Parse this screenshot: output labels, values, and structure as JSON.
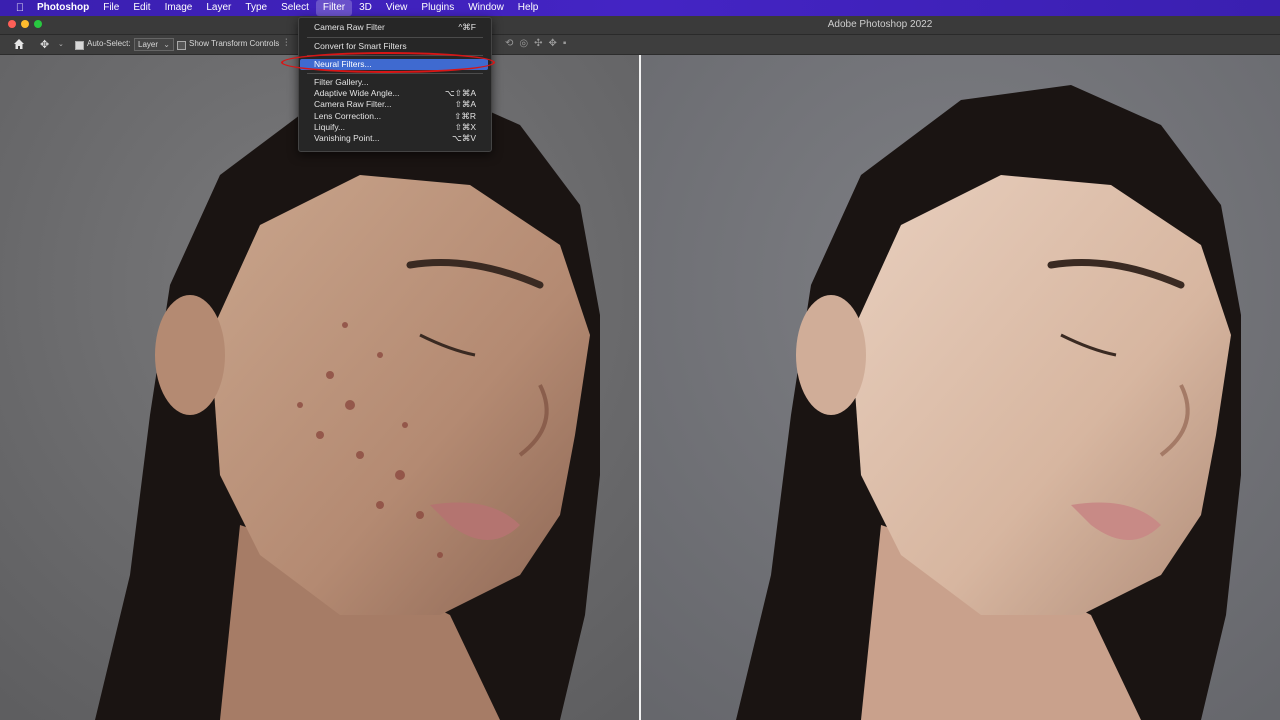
{
  "menubar": {
    "apple_icon": "apple-logo-icon",
    "app_name": "Photoshop",
    "items": [
      "File",
      "Edit",
      "Image",
      "Layer",
      "Type",
      "Select",
      "Filter",
      "3D",
      "View",
      "Plugins",
      "Window",
      "Help"
    ],
    "active_item": "Filter"
  },
  "window": {
    "title": "Adobe Photoshop 2022"
  },
  "options_bar": {
    "auto_select_label": "Auto-Select:",
    "auto_select_checked": true,
    "auto_select_value": "Layer",
    "show_transform_label": "Show Transform Controls",
    "show_transform_checked": false
  },
  "filter_menu": {
    "items": [
      {
        "label": "Camera Raw Filter",
        "shortcut": "^⌘F"
      },
      {
        "label": "Convert for Smart Filters",
        "shortcut": ""
      },
      {
        "label": "Neural Filters...",
        "shortcut": "",
        "highlighted": true
      },
      {
        "label": "Filter Gallery...",
        "shortcut": ""
      },
      {
        "label": "Adaptive Wide Angle...",
        "shortcut": "⌥⇧⌘A"
      },
      {
        "label": "Camera Raw Filter...",
        "shortcut": "⇧⌘A"
      },
      {
        "label": "Lens Correction...",
        "shortcut": "⇧⌘R"
      },
      {
        "label": "Liquify...",
        "shortcut": "⇧⌘X"
      },
      {
        "label": "Vanishing Point...",
        "shortcut": "⌥⌘V"
      }
    ]
  },
  "colors": {
    "menubar": "#3f22bb",
    "menu_highlight": "#3f6ad0",
    "annotation_ring": "#d81616"
  }
}
